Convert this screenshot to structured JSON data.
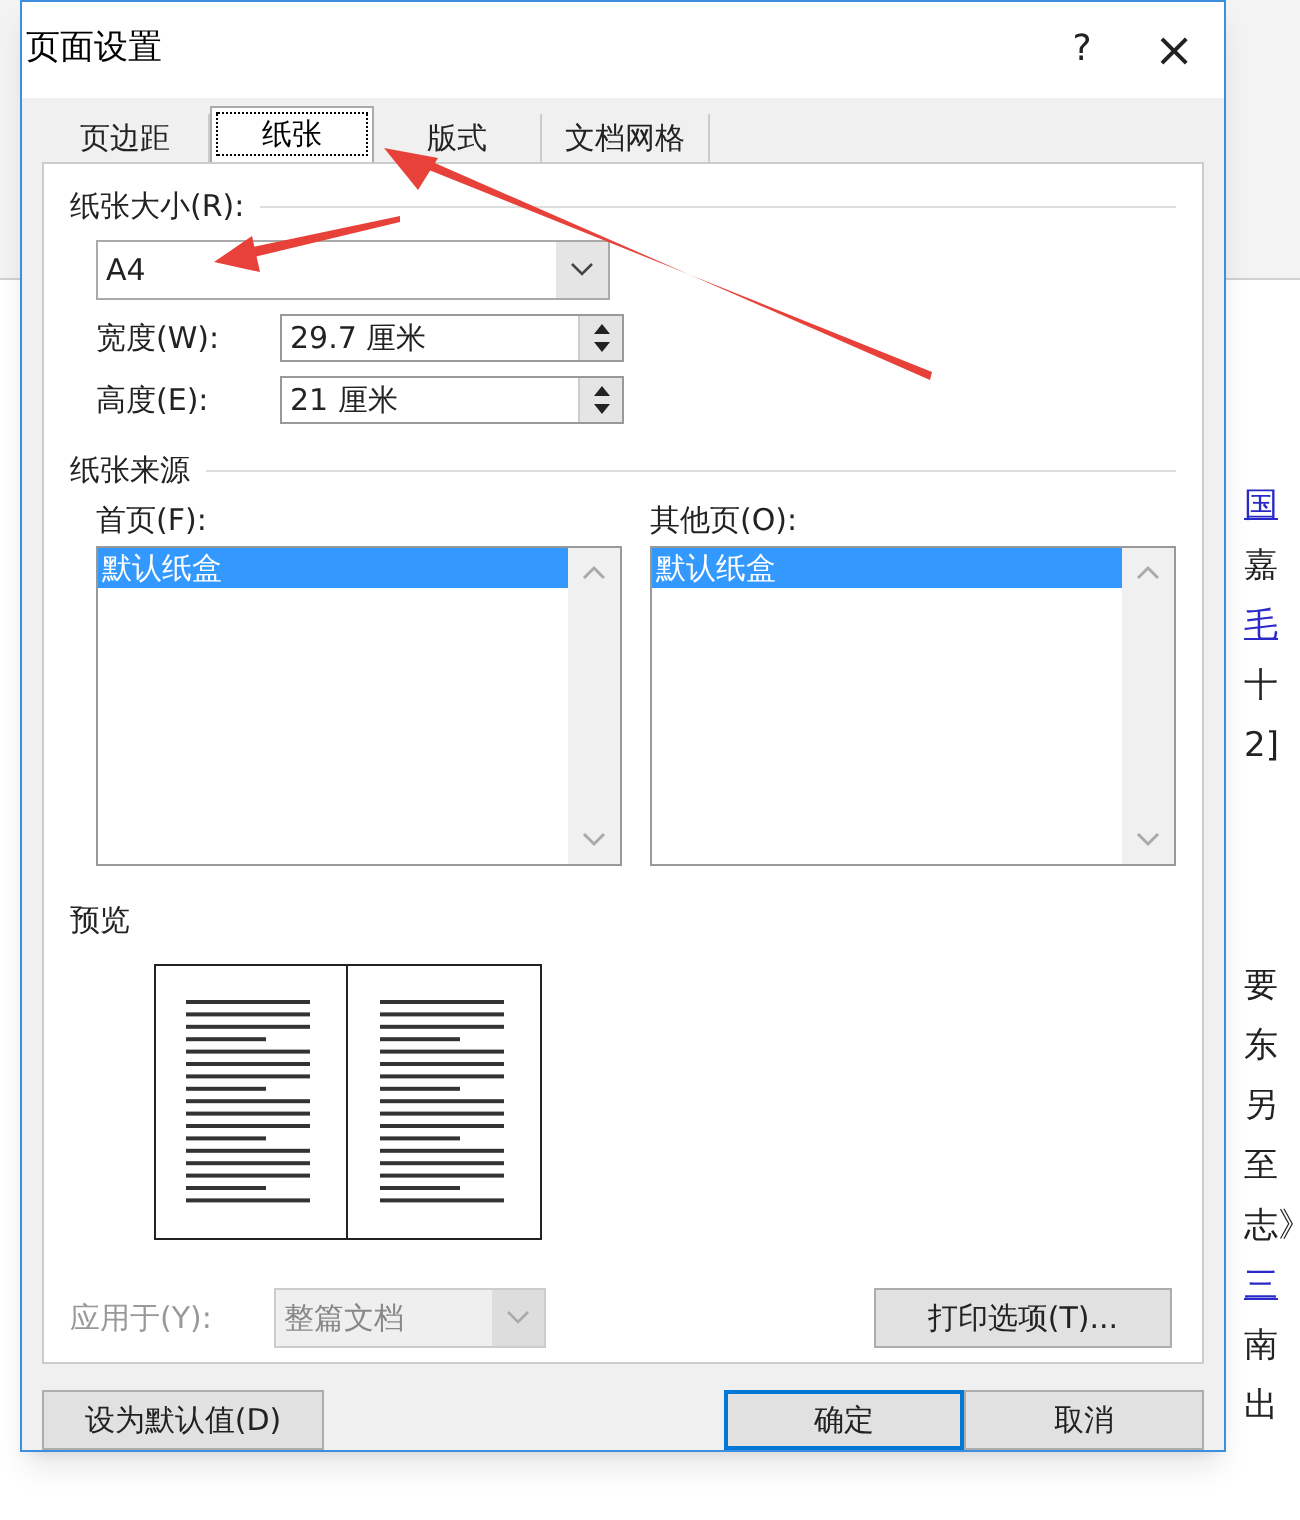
{
  "dialog": {
    "title": "页面设置",
    "help": "?",
    "close": "×"
  },
  "tabs": [
    {
      "label": "页边距",
      "selected": false
    },
    {
      "label": "纸张",
      "selected": true
    },
    {
      "label": "版式",
      "selected": false
    },
    {
      "label": "文档网格",
      "selected": false
    }
  ],
  "paper_size": {
    "label": "纸张大小(R):",
    "value": "A4",
    "width": {
      "label": "宽度(W):",
      "value": "29.7 厘米"
    },
    "height": {
      "label": "高度(E):",
      "value": "21 厘米"
    }
  },
  "paper_source": {
    "title": "纸张来源",
    "first_page": {
      "label": "首页(F):",
      "items": [
        {
          "label": "默认纸盒",
          "selected": true
        }
      ]
    },
    "other_pages": {
      "label": "其他页(O):",
      "items": [
        {
          "label": "默认纸盒",
          "selected": true
        }
      ]
    }
  },
  "preview": {
    "title": "预览"
  },
  "apply_to": {
    "label": "应用于(Y):",
    "value": "整篇文档",
    "disabled": true
  },
  "print_options": "打印选项(T)...",
  "buttons": {
    "set_default": "设为默认值(D)",
    "ok": "确定",
    "cancel": "取消"
  },
  "document": {
    "lines": [
      {
        "text": "国",
        "link": true
      },
      {
        "text": "嘉",
        "link": false
      },
      {
        "text": "毛",
        "link": true
      },
      {
        "text": "十",
        "link": false
      },
      {
        "text": "2]",
        "link": false
      },
      {
        "text": "要",
        "link": false
      },
      {
        "text": "东",
        "link": false
      },
      {
        "text": "另",
        "link": false
      },
      {
        "text": "至",
        "link": false
      },
      {
        "text": "志》",
        "link": false
      },
      {
        "text": "三",
        "link": true
      },
      {
        "text": "南",
        "link": false
      },
      {
        "text": "出",
        "link": false
      }
    ]
  }
}
